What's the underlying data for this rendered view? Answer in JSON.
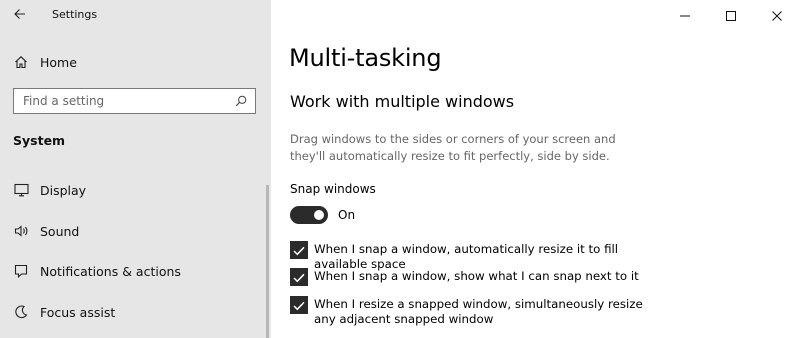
{
  "window": {
    "app_title": "Settings"
  },
  "sidebar": {
    "home_label": "Home",
    "search_placeholder": "Find a setting",
    "section_title": "System",
    "items": [
      {
        "label": "Display",
        "icon": "display-icon"
      },
      {
        "label": "Sound",
        "icon": "sound-icon"
      },
      {
        "label": "Notifications & actions",
        "icon": "notifications-icon"
      },
      {
        "label": "Focus assist",
        "icon": "focus-assist-icon"
      }
    ]
  },
  "main": {
    "page_title": "Multi-tasking",
    "subheading": "Work with multiple windows",
    "description": "Drag windows to the sides or corners of your screen and they'll automatically resize to fit perfectly, side by side.",
    "snap_label": "Snap windows",
    "snap_toggle": {
      "state_label": "On",
      "on": true
    },
    "checkboxes": [
      {
        "label": "When I snap a window, automatically resize it to fill available space",
        "checked": true
      },
      {
        "label": "When I snap a window, show what I can snap next to it",
        "checked": true
      },
      {
        "label": "When I resize a snapped window, simultaneously resize any adjacent snapped window",
        "checked": true
      }
    ]
  },
  "colors": {
    "sidebar_bg": "#e6e6e6",
    "toggle_on": "#2b2b2b",
    "checkbox_on": "#2b2b2b",
    "description_text": "#666666"
  }
}
